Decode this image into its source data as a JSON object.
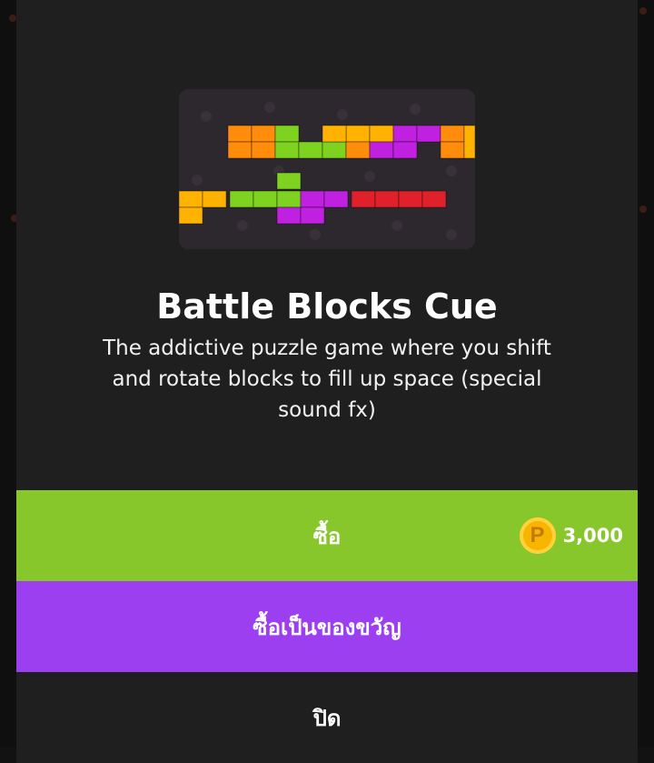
{
  "game": {
    "title": "Battle Blocks Cue",
    "description": "The addictive puzzle game where you shift and rotate blocks to fill up space (special sound fx)",
    "thumbnail_icon": "tetris-blocks-thumbnail"
  },
  "actions": {
    "buy_label": "ซื้อ",
    "price": "3,000",
    "currency_icon": "p-coin-icon",
    "gift_label": "ซื้อเป็นของขวัญ",
    "close_label": "ปิด"
  },
  "colors": {
    "buy": "#88c72c",
    "gift": "#9b3ff0",
    "modal": "#1f1f1f",
    "coin": "#f7b500"
  }
}
